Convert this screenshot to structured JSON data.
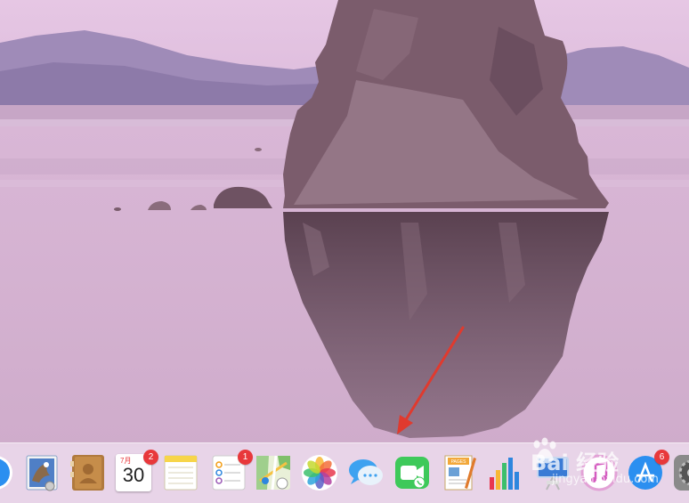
{
  "wallpaper": {
    "scene": "mono-lake-tufa",
    "sky_color": "#e2c3e2",
    "mountain_color": "#9b87b4",
    "water_color": "#d3b1cf",
    "rock_color": "#7a5a6a"
  },
  "annotation": {
    "color": "#e03a2e"
  },
  "dock": {
    "items": [
      {
        "name": "safari-icon"
      },
      {
        "name": "mail-icon"
      },
      {
        "name": "contacts-icon"
      },
      {
        "name": "calendar-icon",
        "month": "7月",
        "day": "30",
        "badge": "2"
      },
      {
        "name": "notes-icon"
      },
      {
        "name": "reminders-icon",
        "badge": "1"
      },
      {
        "name": "maps-icon"
      },
      {
        "name": "photos-icon"
      },
      {
        "name": "messages-icon"
      },
      {
        "name": "facetime-icon"
      },
      {
        "name": "pages-icon",
        "label": "PAGES"
      },
      {
        "name": "numbers-icon"
      },
      {
        "name": "keynote-icon"
      },
      {
        "name": "itunes-icon"
      },
      {
        "name": "app-store-icon",
        "badge": "6"
      },
      {
        "name": "system-preferences-icon"
      }
    ]
  },
  "watermark": {
    "title": "Bai 经验",
    "url": "jingyan.baidu.com"
  }
}
